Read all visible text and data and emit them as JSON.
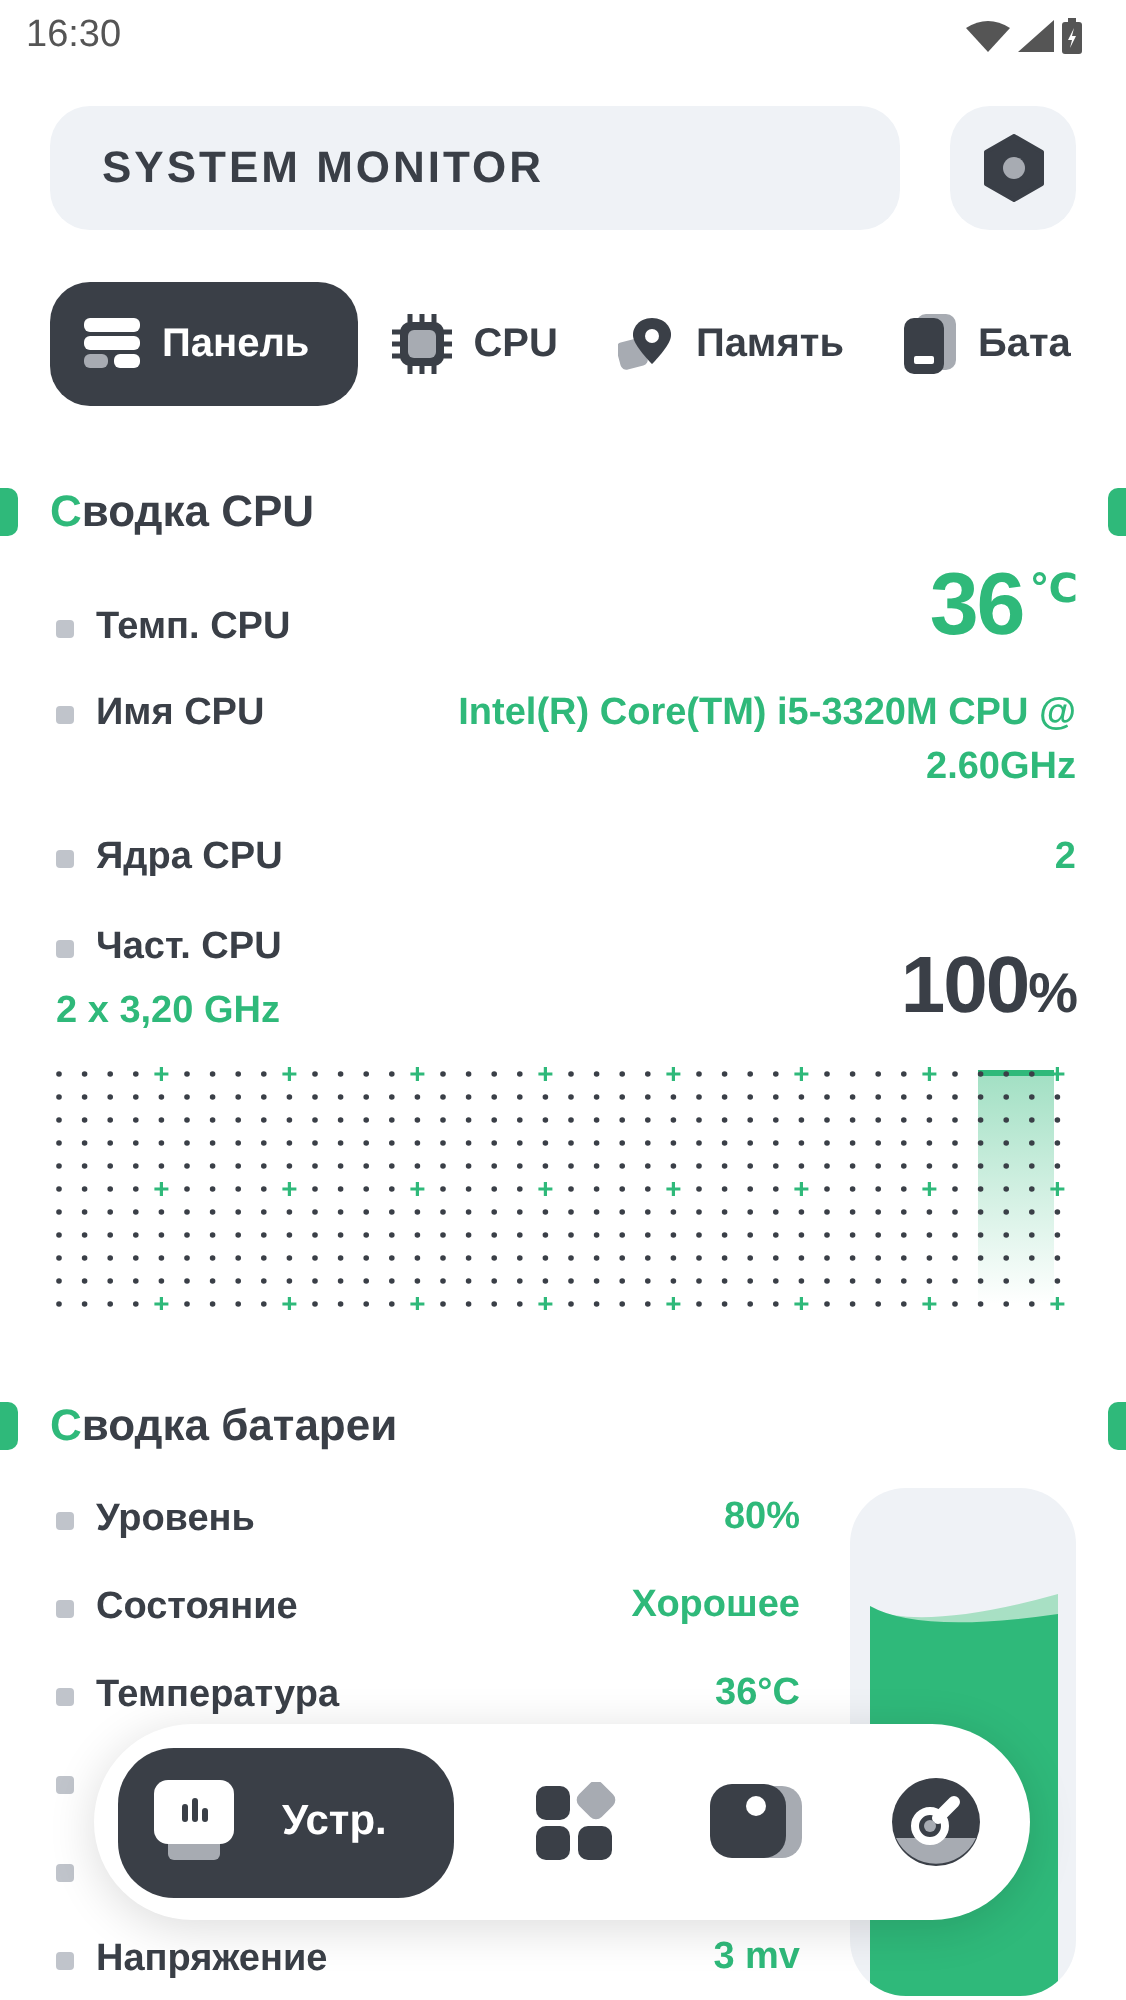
{
  "status_bar": {
    "time": "16:30"
  },
  "header": {
    "title": "SYSTEM MONITOR"
  },
  "tabs": [
    {
      "label": "Панель",
      "selected": true
    },
    {
      "label": "CPU",
      "selected": false
    },
    {
      "label": "Память",
      "selected": false
    },
    {
      "label": "Бата",
      "selected": false
    }
  ],
  "cpu_summary": {
    "title": "Сводка CPU",
    "rows": [
      {
        "kind": "big",
        "label": "Темп. CPU",
        "value": "36",
        "unit": "℃"
      },
      {
        "kind": "text",
        "label": "Имя CPU",
        "value": "Intel(R) Core(TM) i5-3320M CPU @ 2.60GHz"
      },
      {
        "kind": "text",
        "label": "Ядра CPU",
        "value": "2"
      },
      {
        "kind": "usage",
        "label": "Част. CPU",
        "sub": "2 x 3,20 GHz",
        "value": "100",
        "unit": "%"
      }
    ]
  },
  "battery_summary": {
    "title": "Сводка батареи",
    "rows": [
      {
        "kind": "text",
        "label": "Уровень",
        "value": "80%"
      },
      {
        "kind": "text",
        "label": "Состояние",
        "value": "Хорошее"
      },
      {
        "kind": "text",
        "label": "Температура",
        "value": "36°C"
      },
      {
        "kind": "covered"
      },
      {
        "kind": "covered"
      },
      {
        "kind": "text",
        "label": "Напряжение",
        "value": "3 mv"
      }
    ]
  },
  "bottom_nav": [
    {
      "label": "Устр.",
      "selected": true
    },
    {
      "selected": false
    },
    {
      "selected": false
    },
    {
      "selected": false
    }
  ]
}
